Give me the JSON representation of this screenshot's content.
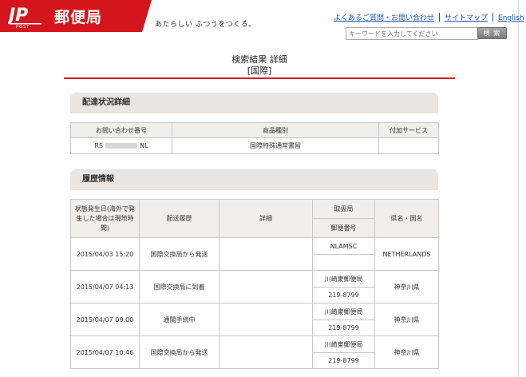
{
  "header": {
    "logo_text": "郵便局",
    "tagline": "あたらしい ふつうをつくる。",
    "links": [
      "よくあるご質問・お問い合わせ",
      "サイトマップ",
      "English"
    ],
    "search_placeholder": "キーワードを入力してください",
    "search_button": "検 索",
    "brand_color": "#d4151b"
  },
  "title": {
    "line1": "検索結果 詳細",
    "line2": "[国際]"
  },
  "delivery_status": {
    "heading": "配達状況詳細",
    "columns": [
      "お問い合わせ番号",
      "商品種別",
      "付加サービス"
    ],
    "row": {
      "inquiry_prefix": "RS",
      "inquiry_suffix": "NL",
      "product_type": "国際特殊通常書留",
      "additional_service": ""
    }
  },
  "history": {
    "heading": "履歴情報",
    "columns": {
      "date": "状態発生日(海外で発生した場合は現地時間)",
      "status": "配送履歴",
      "detail": "詳細",
      "office": "取扱局",
      "postal_code": "郵便番号",
      "region": "県名・国名"
    },
    "rows": [
      {
        "date": "2015/04/03 15:20",
        "status": "国際交換局から発送",
        "detail": "",
        "office": "NLAMSC",
        "postal_code": "",
        "region": "NETHERLANDS"
      },
      {
        "date": "2015/04/07 04:13",
        "status": "国際交換局に到着",
        "detail": "",
        "office": "川崎東郵便局",
        "postal_code": "219-8799",
        "region": "神奈川県"
      },
      {
        "date": "2015/04/07 09:00",
        "status": "通関手続中",
        "detail": "",
        "office": "川崎東郵便局",
        "postal_code": "219-8799",
        "region": "神奈川県"
      },
      {
        "date": "2015/04/07 10:46",
        "status": "国際交換局から発送",
        "detail": "",
        "office": "川崎東郵便局",
        "postal_code": "219-8799",
        "region": "神奈川県"
      }
    ]
  }
}
